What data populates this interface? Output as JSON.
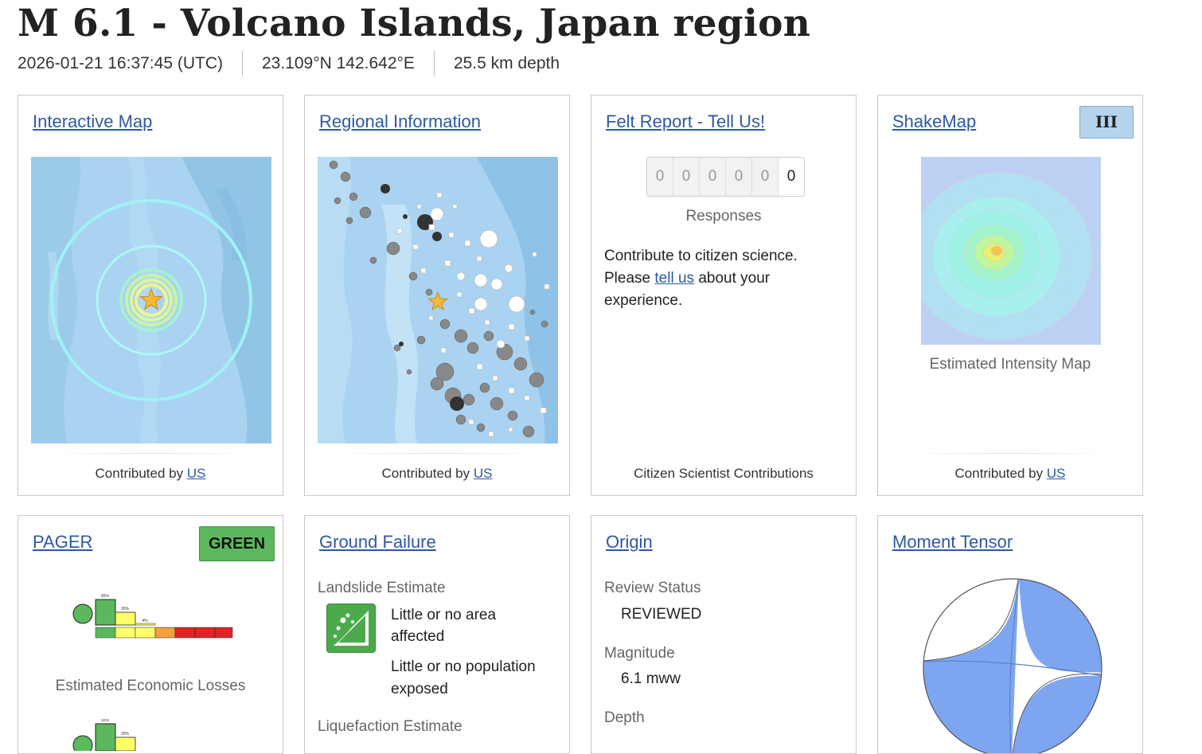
{
  "event": {
    "title": "M 6.1 - Volcano Islands, Japan region",
    "time": "2026-01-21 16:37:45 (UTC)",
    "location": "23.109°N 142.642°E",
    "depth": "25.5 km depth"
  },
  "cards": {
    "interactive_map": {
      "title": "Interactive Map",
      "contributed_prefix": "Contributed by",
      "contributor": "US"
    },
    "regional_info": {
      "title": "Regional Information",
      "contributed_prefix": "Contributed by",
      "contributor": "US"
    },
    "felt_report": {
      "title": "Felt Report - Tell Us!",
      "digits": [
        "0",
        "0",
        "0",
        "0",
        "0",
        "0"
      ],
      "responses_label": "Responses",
      "text_line1": "Contribute to citizen science.",
      "text_please": "Please",
      "text_link": "tell us",
      "text_after_link": "about your",
      "text_line3": "experience.",
      "footer": "Citizen Scientist Contributions"
    },
    "shakemap": {
      "title": "ShakeMap",
      "intensity_badge": "III",
      "caption": "Estimated Intensity Map",
      "contributed_prefix": "Contributed by",
      "contributor": "US"
    },
    "pager": {
      "title": "PAGER",
      "alert_badge": "GREEN",
      "caption": "Estimated Economic Losses",
      "histogram_percent_labels": [
        "65%",
        "30%",
        "4%"
      ],
      "histogram_percents": [
        65,
        30,
        4
      ]
    },
    "ground_failure": {
      "title": "Ground Failure",
      "landslide_label": "Landslide Estimate",
      "landslide_line1": "Little or no area",
      "landslide_line2": "affected",
      "population_line1": "Little or no population",
      "population_line2": "exposed",
      "liquefaction_label": "Liquefaction Estimate"
    },
    "origin": {
      "title": "Origin",
      "review_status_label": "Review Status",
      "review_status_value": "REVIEWED",
      "magnitude_label": "Magnitude",
      "magnitude_value": "6.1 mww",
      "depth_label": "Depth"
    },
    "moment_tensor": {
      "title": "Moment Tensor"
    }
  },
  "colors": {
    "link": "#2c5aa0",
    "pager_green": "#5cb85c",
    "shakemap_badge": "#b3d4ec",
    "beachball_fill": "#7ea6f0",
    "map_water": "#a9d3f0"
  },
  "icons": [
    "star-icon",
    "landslide-icon"
  ]
}
